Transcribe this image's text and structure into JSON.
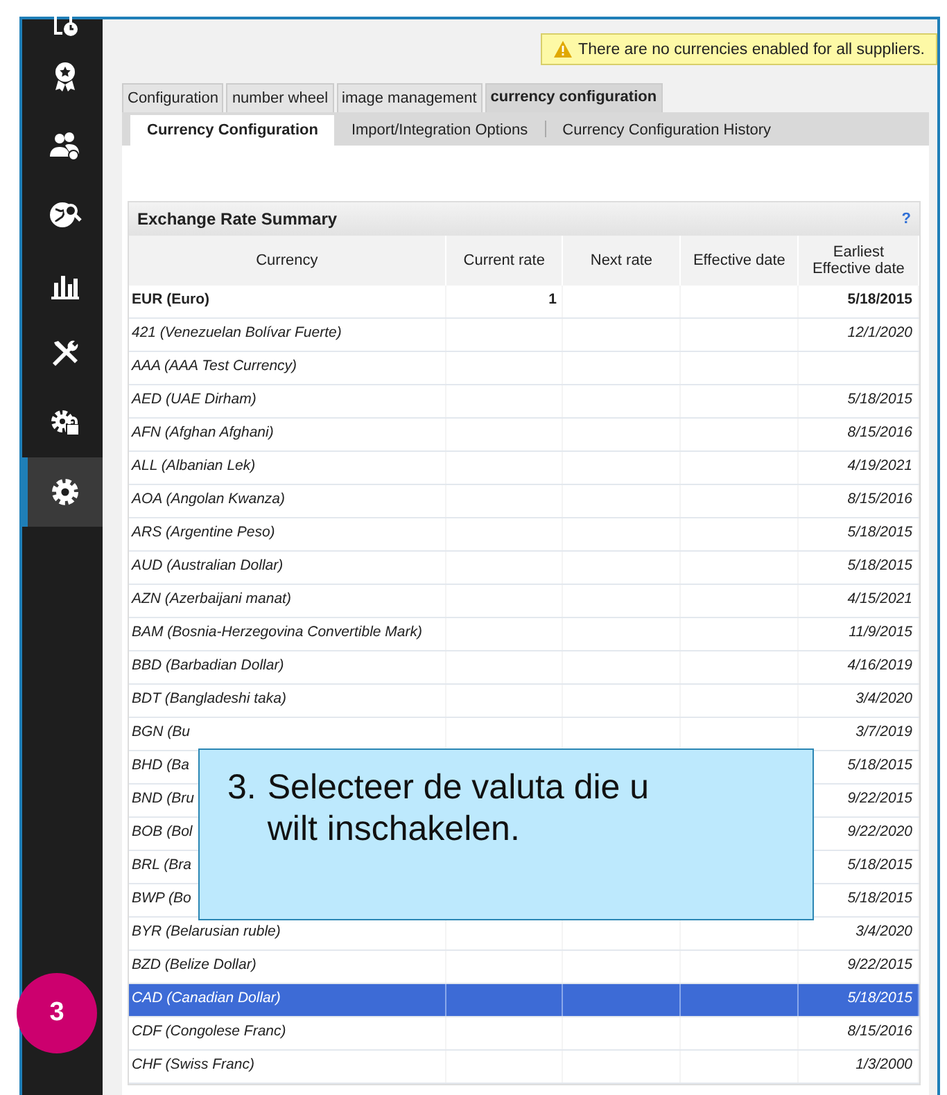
{
  "sidebar": {
    "items": [
      {
        "kind": "document-clock",
        "selected": false
      },
      {
        "kind": "award",
        "selected": false
      },
      {
        "kind": "users",
        "selected": false
      },
      {
        "kind": "globe-search",
        "selected": false
      },
      {
        "kind": "bar-chart",
        "selected": false
      },
      {
        "kind": "tools",
        "selected": false
      },
      {
        "kind": "gear-lock",
        "selected": false
      },
      {
        "kind": "gear",
        "selected": true
      }
    ]
  },
  "warning": "There are no currencies enabled for all suppliers.",
  "tabs": [
    {
      "label": "Configuration",
      "selected": false
    },
    {
      "label": "number wheel",
      "selected": false
    },
    {
      "label": "image management",
      "selected": false
    },
    {
      "label": "currency configuration",
      "selected": true
    }
  ],
  "subtabs": [
    {
      "label": "Currency Configuration",
      "selected": true
    },
    {
      "label": "Import/Integration Options",
      "selected": false
    },
    {
      "label": "Currency Configuration History",
      "selected": false
    }
  ],
  "panel": {
    "title": "Exchange Rate Summary",
    "help": "?",
    "columns": [
      "Currency",
      "Current rate",
      "Next rate",
      "Effective date",
      "Earliest Effective date"
    ],
    "rows": [
      {
        "cells": [
          "EUR (Euro)",
          "1",
          "",
          "",
          "5/18/2015"
        ],
        "base": true,
        "selected": false
      },
      {
        "cells": [
          "421 (Venezuelan Bolívar Fuerte)",
          "",
          "",
          "",
          "12/1/2020"
        ],
        "base": false,
        "selected": false
      },
      {
        "cells": [
          "AAA (AAA Test Currency)",
          "",
          "",
          "",
          ""
        ],
        "base": false,
        "selected": false
      },
      {
        "cells": [
          "AED (UAE Dirham)",
          "",
          "",
          "",
          "5/18/2015"
        ],
        "base": false,
        "selected": false
      },
      {
        "cells": [
          "AFN (Afghan Afghani)",
          "",
          "",
          "",
          "8/15/2016"
        ],
        "base": false,
        "selected": false
      },
      {
        "cells": [
          "ALL (Albanian Lek)",
          "",
          "",
          "",
          "4/19/2021"
        ],
        "base": false,
        "selected": false
      },
      {
        "cells": [
          "AOA (Angolan Kwanza)",
          "",
          "",
          "",
          "8/15/2016"
        ],
        "base": false,
        "selected": false
      },
      {
        "cells": [
          "ARS (Argentine Peso)",
          "",
          "",
          "",
          "5/18/2015"
        ],
        "base": false,
        "selected": false
      },
      {
        "cells": [
          "AUD (Australian Dollar)",
          "",
          "",
          "",
          "5/18/2015"
        ],
        "base": false,
        "selected": false
      },
      {
        "cells": [
          "AZN (Azerbaijani manat)",
          "",
          "",
          "",
          "4/15/2021"
        ],
        "base": false,
        "selected": false
      },
      {
        "cells": [
          "BAM (Bosnia-Herzegovina Convertible Mark)",
          "",
          "",
          "",
          "11/9/2015"
        ],
        "base": false,
        "selected": false
      },
      {
        "cells": [
          "BBD (Barbadian Dollar)",
          "",
          "",
          "",
          "4/16/2019"
        ],
        "base": false,
        "selected": false
      },
      {
        "cells": [
          "BDT (Bangladeshi taka)",
          "",
          "",
          "",
          "3/4/2020"
        ],
        "base": false,
        "selected": false
      },
      {
        "cells": [
          "BGN (Bu",
          "",
          "",
          "",
          "3/7/2019"
        ],
        "base": false,
        "selected": false
      },
      {
        "cells": [
          "BHD (Ba",
          "",
          "",
          "",
          "5/18/2015"
        ],
        "base": false,
        "selected": false
      },
      {
        "cells": [
          "BND (Bru",
          "",
          "",
          "",
          "9/22/2015"
        ],
        "base": false,
        "selected": false
      },
      {
        "cells": [
          "BOB (Bol",
          "",
          "",
          "",
          "9/22/2020"
        ],
        "base": false,
        "selected": false
      },
      {
        "cells": [
          "BRL (Bra",
          "",
          "",
          "",
          "5/18/2015"
        ],
        "base": false,
        "selected": false
      },
      {
        "cells": [
          "BWP (Bo",
          "",
          "",
          "",
          "5/18/2015"
        ],
        "base": false,
        "selected": false
      },
      {
        "cells": [
          "BYR (Belarusian ruble)",
          "",
          "",
          "",
          "3/4/2020"
        ],
        "base": false,
        "selected": false
      },
      {
        "cells": [
          "BZD (Belize Dollar)",
          "",
          "",
          "",
          "9/22/2015"
        ],
        "base": false,
        "selected": false
      },
      {
        "cells": [
          "CAD (Canadian Dollar)",
          "",
          "",
          "",
          "5/18/2015"
        ],
        "base": false,
        "selected": true
      },
      {
        "cells": [
          "CDF (Congolese Franc)",
          "",
          "",
          "",
          "8/15/2016"
        ],
        "base": false,
        "selected": false
      },
      {
        "cells": [
          "CHF (Swiss Franc)",
          "",
          "",
          "",
          "1/3/2000"
        ],
        "base": false,
        "selected": false
      }
    ]
  },
  "callout": {
    "number": "3.",
    "text": "Selecteer de valuta die u wilt inschakelen."
  },
  "step_badge": "3"
}
